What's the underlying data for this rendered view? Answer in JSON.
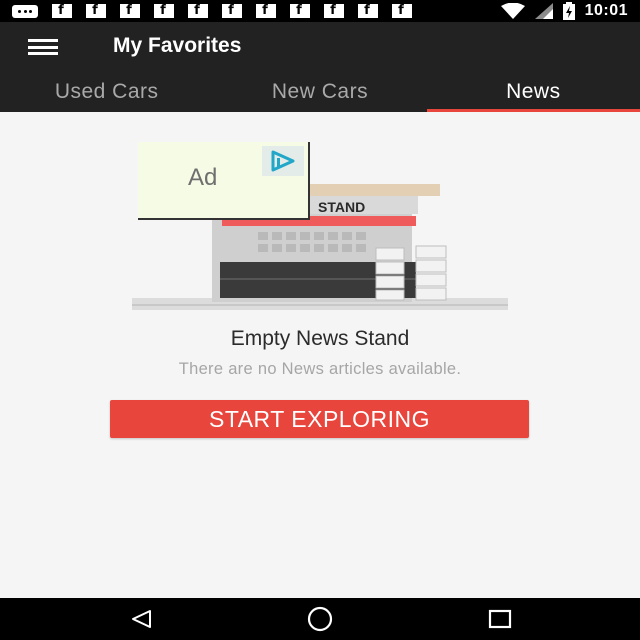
{
  "status_bar": {
    "time": "10:01",
    "icons": [
      "message-icon",
      "facebook-icon",
      "facebook-icon",
      "facebook-icon",
      "facebook-icon",
      "facebook-icon",
      "facebook-icon",
      "facebook-icon",
      "facebook-icon",
      "facebook-icon",
      "facebook-icon",
      "facebook-icon",
      "wifi-icon",
      "cell-signal-icon",
      "battery-charging-icon"
    ]
  },
  "app_bar": {
    "title": "My Favorites",
    "menu_icon": "hamburger-menu-icon"
  },
  "tabs": [
    {
      "label": "Used Cars",
      "active": false
    },
    {
      "label": "New Cars",
      "active": false
    },
    {
      "label": "News",
      "active": true
    }
  ],
  "empty_state": {
    "ad_label": "Ad",
    "sign_text": "STAND",
    "title": "Empty News Stand",
    "subtitle": "There are no News articles available.",
    "button_label": "START EXPLORING"
  },
  "nav_bar": {
    "icons": [
      "back-icon",
      "home-icon",
      "recents-icon"
    ]
  },
  "colors": {
    "app_bar_bg": "#222222",
    "accent": "#e8453c",
    "status_bar_bg": "#000000"
  }
}
